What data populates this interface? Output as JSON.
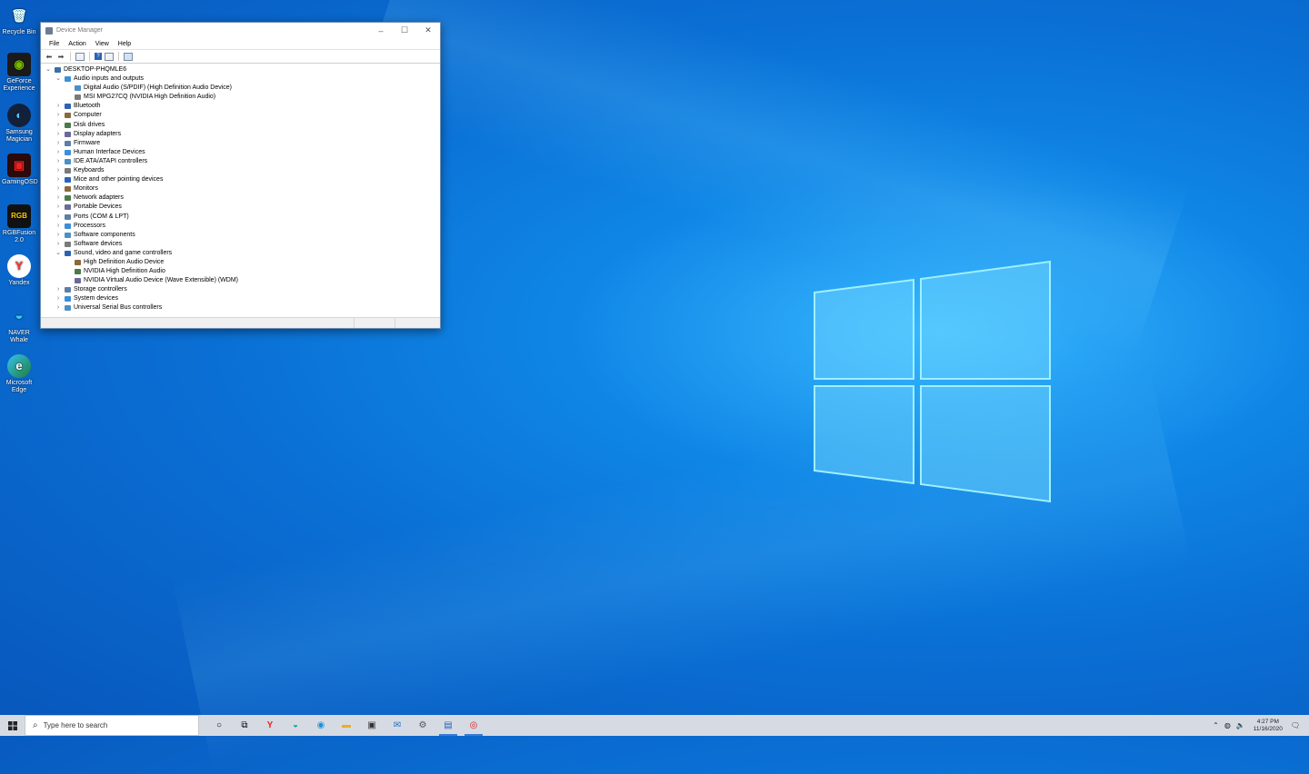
{
  "desktop": {
    "icons": [
      {
        "label": "Recycle Bin",
        "icon": "recycle-bin-icon"
      },
      {
        "label": "GeForce Experience",
        "icon": "geforce-icon"
      },
      {
        "label": "Samsung Magician",
        "icon": "samsung-magician-icon"
      },
      {
        "label": "GamingOSD",
        "icon": "gaming-osd-icon"
      },
      {
        "label": "RGBFusion 2.0",
        "icon": "rgb-fusion-icon"
      },
      {
        "label": "Yandex",
        "icon": "yandex-icon"
      },
      {
        "label": "NAVER Whale",
        "icon": "naver-whale-icon"
      },
      {
        "label": "Microsoft Edge",
        "icon": "edge-icon"
      }
    ]
  },
  "window": {
    "title": "Device Manager",
    "menu": [
      "File",
      "Action",
      "View",
      "Help"
    ],
    "tree": [
      {
        "label": "DESKTOP-PHQMLE6",
        "depth": 0,
        "expander": "expanded"
      },
      {
        "label": "Audio inputs and outputs",
        "depth": 1,
        "expander": "expanded"
      },
      {
        "label": "Digital Audio (S/PDIF) (High Definition Audio Device)",
        "depth": 2,
        "expander": "none"
      },
      {
        "label": "MSI MPG27CQ (NVIDIA High Definition Audio)",
        "depth": 2,
        "expander": "none"
      },
      {
        "label": "Bluetooth",
        "depth": 1,
        "expander": "collapsed"
      },
      {
        "label": "Computer",
        "depth": 1,
        "expander": "collapsed"
      },
      {
        "label": "Disk drives",
        "depth": 1,
        "expander": "collapsed"
      },
      {
        "label": "Display adapters",
        "depth": 1,
        "expander": "collapsed"
      },
      {
        "label": "Firmware",
        "depth": 1,
        "expander": "collapsed"
      },
      {
        "label": "Human Interface Devices",
        "depth": 1,
        "expander": "collapsed"
      },
      {
        "label": "IDE ATA/ATAPI controllers",
        "depth": 1,
        "expander": "collapsed"
      },
      {
        "label": "Keyboards",
        "depth": 1,
        "expander": "collapsed"
      },
      {
        "label": "Mice and other pointing devices",
        "depth": 1,
        "expander": "collapsed"
      },
      {
        "label": "Monitors",
        "depth": 1,
        "expander": "collapsed"
      },
      {
        "label": "Network adapters",
        "depth": 1,
        "expander": "collapsed"
      },
      {
        "label": "Portable Devices",
        "depth": 1,
        "expander": "collapsed"
      },
      {
        "label": "Ports (COM & LPT)",
        "depth": 1,
        "expander": "collapsed"
      },
      {
        "label": "Processors",
        "depth": 1,
        "expander": "collapsed"
      },
      {
        "label": "Software components",
        "depth": 1,
        "expander": "collapsed"
      },
      {
        "label": "Software devices",
        "depth": 1,
        "expander": "collapsed"
      },
      {
        "label": "Sound, video and game controllers",
        "depth": 1,
        "expander": "expanded"
      },
      {
        "label": "High Definition Audio Device",
        "depth": 2,
        "expander": "none"
      },
      {
        "label": "NVIDIA High Definition Audio",
        "depth": 2,
        "expander": "none"
      },
      {
        "label": "NVIDIA Virtual Audio Device (Wave Extensible) (WDM)",
        "depth": 2,
        "expander": "none"
      },
      {
        "label": "Storage controllers",
        "depth": 1,
        "expander": "collapsed"
      },
      {
        "label": "System devices",
        "depth": 1,
        "expander": "collapsed"
      },
      {
        "label": "Universal Serial Bus controllers",
        "depth": 1,
        "expander": "collapsed"
      }
    ]
  },
  "taskbar": {
    "search_placeholder": "Type here to search",
    "apps": [
      "cortana-icon",
      "task-view-icon",
      "yandex-icon",
      "naver-whale-icon",
      "edge-icon",
      "file-explorer-icon",
      "store-icon",
      "mail-icon",
      "app-icon",
      "device-manager-icon",
      "media-icon"
    ],
    "time": "4:27 PM",
    "date": "11/16/2020"
  },
  "colors": {
    "desktop_blue": "#0a6fd4",
    "accent": "#3a7bd5"
  }
}
